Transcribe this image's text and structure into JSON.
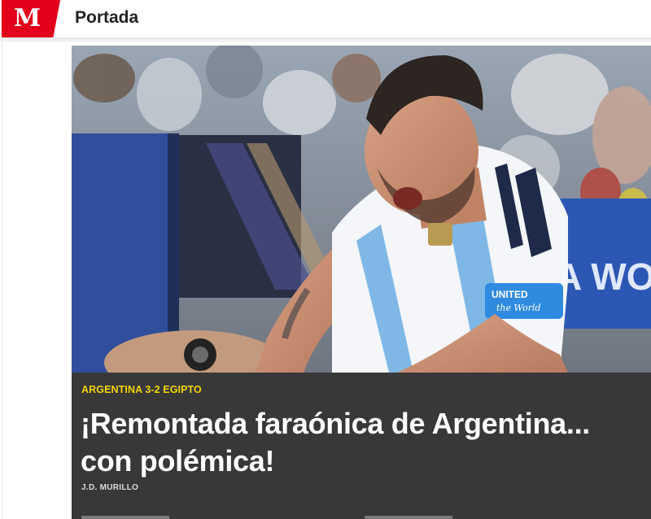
{
  "header": {
    "logo_letter": "M",
    "section_title": "Portada"
  },
  "hero": {
    "image_alt_icon": "photo-soccer-celebration",
    "armband_text_1": "UNITED",
    "armband_text_2": "the World",
    "banner_text": "A WO"
  },
  "article": {
    "kicker": "ARGENTINA 3-2 EGIPTO",
    "headline": "¡Remontada faraónica de Argentina... con polémica!",
    "byline": "J.D. MURILLO"
  },
  "colors": {
    "brand": "#e2001a",
    "kicker": "#f3d300",
    "caption_bg": "#383838"
  }
}
